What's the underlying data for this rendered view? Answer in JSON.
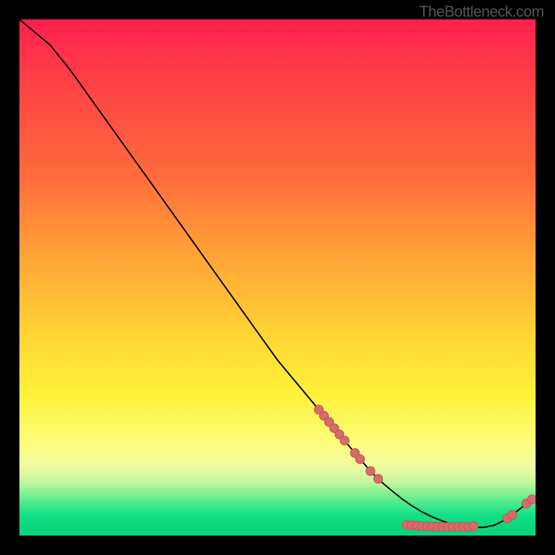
{
  "watermark": "TheBottleneck.com",
  "chart_data": {
    "type": "line",
    "title": "",
    "xlabel": "",
    "ylabel": "",
    "xlim": [
      0,
      100
    ],
    "ylim": [
      0,
      100
    ],
    "series": [
      {
        "name": "curve",
        "x": [
          0,
          6,
          10,
          15,
          20,
          25,
          30,
          35,
          40,
          45,
          50,
          55,
          60,
          65,
          68,
          70,
          72,
          74,
          76,
          78,
          80,
          82,
          84,
          86,
          88,
          90,
          92,
          94,
          96,
          97.5,
          99.5
        ],
        "y": [
          100,
          95,
          90,
          83,
          76,
          69,
          62,
          55,
          48,
          41,
          34,
          28,
          22,
          16,
          12.5,
          10.5,
          8.8,
          7.2,
          5.8,
          4.6,
          3.6,
          2.8,
          2.2,
          1.8,
          1.6,
          1.6,
          2.0,
          3.0,
          4.4,
          5.6,
          7.2
        ]
      }
    ],
    "markers": [
      {
        "x": 58,
        "y": 24.4
      },
      {
        "x": 59,
        "y": 23.2
      },
      {
        "x": 60,
        "y": 22.0
      },
      {
        "x": 61,
        "y": 20.8
      },
      {
        "x": 62,
        "y": 19.6
      },
      {
        "x": 63,
        "y": 18.4
      },
      {
        "x": 65,
        "y": 16.0
      },
      {
        "x": 66,
        "y": 14.8
      },
      {
        "x": 68,
        "y": 12.5
      },
      {
        "x": 69.5,
        "y": 11.0
      },
      {
        "x": 75,
        "y": 2.0
      },
      {
        "x": 76,
        "y": 2.0
      },
      {
        "x": 77,
        "y": 1.9
      },
      {
        "x": 78,
        "y": 1.8
      },
      {
        "x": 79,
        "y": 1.8
      },
      {
        "x": 80,
        "y": 1.7
      },
      {
        "x": 81,
        "y": 1.7
      },
      {
        "x": 82,
        "y": 1.7
      },
      {
        "x": 83,
        "y": 1.7
      },
      {
        "x": 84,
        "y": 1.7
      },
      {
        "x": 85,
        "y": 1.7
      },
      {
        "x": 86,
        "y": 1.7
      },
      {
        "x": 87,
        "y": 1.7
      },
      {
        "x": 88,
        "y": 1.8
      },
      {
        "x": 94.5,
        "y": 3.3
      },
      {
        "x": 95.5,
        "y": 4.0
      },
      {
        "x": 98.2,
        "y": 6.2
      },
      {
        "x": 99.3,
        "y": 7.0
      }
    ],
    "marker_label": "",
    "colors": {
      "curve": "#000000",
      "marker_fill": "#d96a6a",
      "marker_stroke": "#b85555",
      "bg_top": "#ff1f4e",
      "bg_bottom": "#06d57b"
    }
  }
}
